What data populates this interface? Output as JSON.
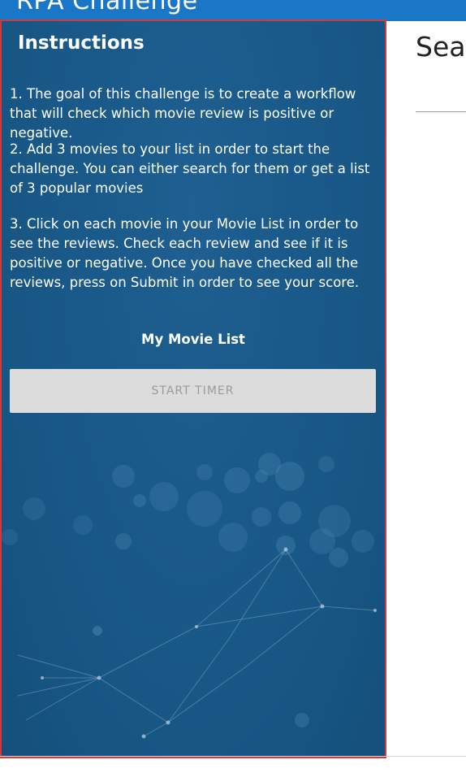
{
  "header": {
    "app_title": "RPA Challenge"
  },
  "instructions": {
    "title": "Instructions",
    "step1": "1. The goal of this challenge is to create a workflow that will check which movie review is positive or negative.",
    "step2": "2. Add 3 movies to your list in order to start the challenge. You can either search for them or get a list of 3 popular movies",
    "step3": "3. Click on each movie in your Movie List in order to see the reviews. Check each review and see if it is positive or negative. Once you have checked all the reviews, press on Submit in order to see your score.",
    "movie_list_title": "My Movie List",
    "start_timer_label": "START TIMER"
  },
  "search_panel": {
    "heading": "Sea"
  },
  "colors": {
    "header_bg": "#1a77c7",
    "panel_bg": "#1a5a8a",
    "panel_border": "#d23a3a",
    "button_bg": "#dcdcdc",
    "button_text": "#9a9a9a"
  }
}
